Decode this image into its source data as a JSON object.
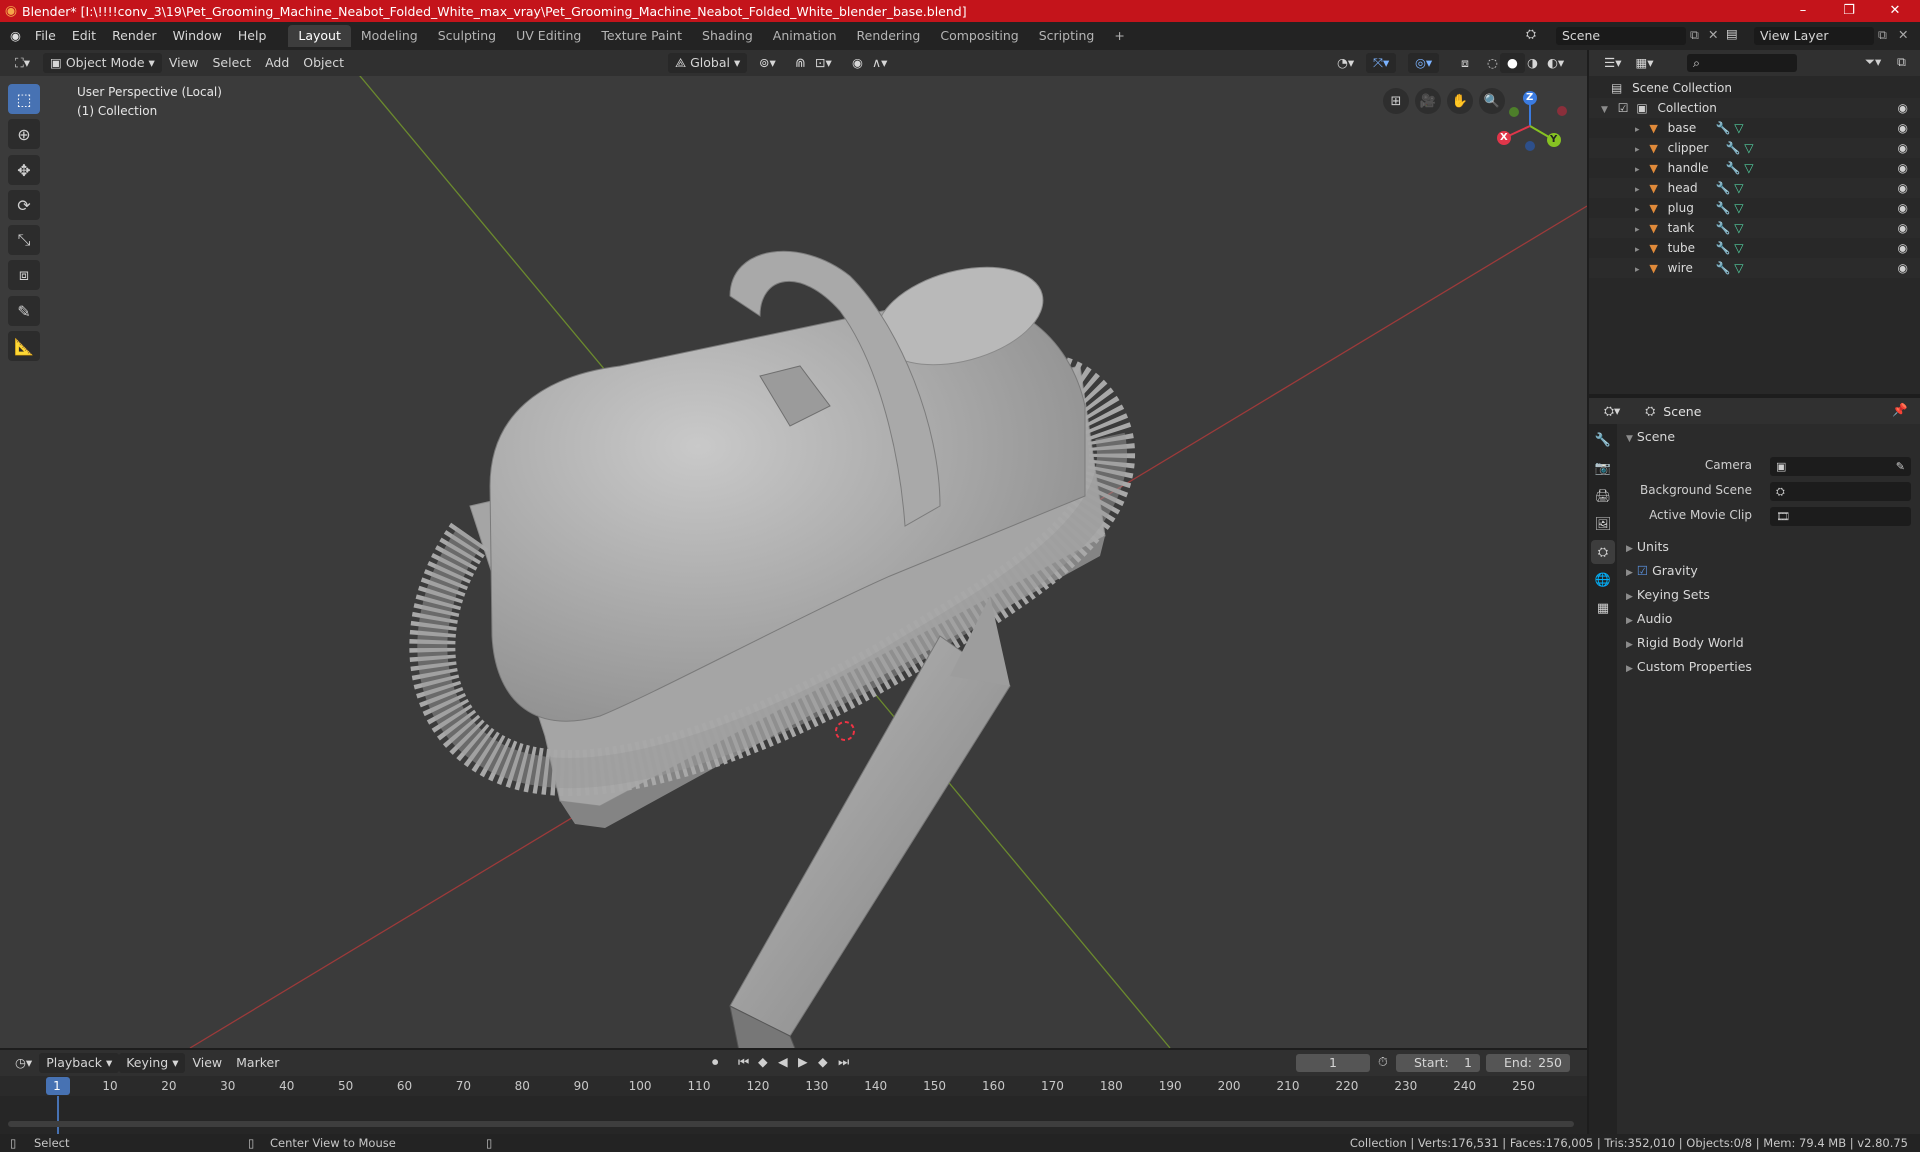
{
  "window": {
    "title": "Blender* [I:\\!!!!conv_3\\19\\Pet_Grooming_Machine_Neabot_Folded_White_max_vray\\Pet_Grooming_Machine_Neabot_Folded_White_blender_base.blend]",
    "minimize": "–",
    "maximize": "❐",
    "close": "✕"
  },
  "menu": [
    "File",
    "Edit",
    "Render",
    "Window",
    "Help"
  ],
  "workspaces": [
    "Layout",
    "Modeling",
    "Sculpting",
    "UV Editing",
    "Texture Paint",
    "Shading",
    "Animation",
    "Rendering",
    "Compositing",
    "Scripting",
    "+"
  ],
  "scene_field": "Scene",
  "view_layer_field": "View Layer",
  "viewport_header": {
    "mode": "Object Mode",
    "menus": [
      "View",
      "Select",
      "Add",
      "Object"
    ],
    "orientation": "Global"
  },
  "viewport_overlay": {
    "line1": "User Perspective (Local)",
    "line2": "(1) Collection"
  },
  "gizmo": {
    "x": "X",
    "y": "Y",
    "z": "Z"
  },
  "outliner": {
    "search_placeholder": "",
    "root": "Scene Collection",
    "collection": "Collection",
    "objects": [
      "base",
      "clipper",
      "handle",
      "head",
      "plug",
      "tank",
      "tube",
      "wire"
    ]
  },
  "properties": {
    "header": "Scene",
    "section_scene": "Scene",
    "camera_label": "Camera",
    "background_label": "Background Scene",
    "clip_label": "Active Movie Clip",
    "sections": [
      "Units",
      "Gravity",
      "Keying Sets",
      "Audio",
      "Rigid Body World",
      "Custom Properties"
    ]
  },
  "timeline": {
    "menus": [
      "Playback",
      "Keying",
      "View",
      "Marker"
    ],
    "current_frame": "1",
    "start_label": "Start:",
    "start": "1",
    "end_label": "End:",
    "end": "250",
    "ticks": [
      "1",
      "10",
      "20",
      "30",
      "40",
      "50",
      "60",
      "70",
      "80",
      "90",
      "100",
      "110",
      "120",
      "130",
      "140",
      "150",
      "160",
      "170",
      "180",
      "190",
      "200",
      "210",
      "220",
      "230",
      "240",
      "250"
    ]
  },
  "status": {
    "left": "Select",
    "middle": "Center View to Mouse",
    "right": "Collection | Verts:176,531 | Faces:176,005 | Tris:352,010 | Objects:0/8 | Mem: 79.4 MB | v2.80.75"
  }
}
